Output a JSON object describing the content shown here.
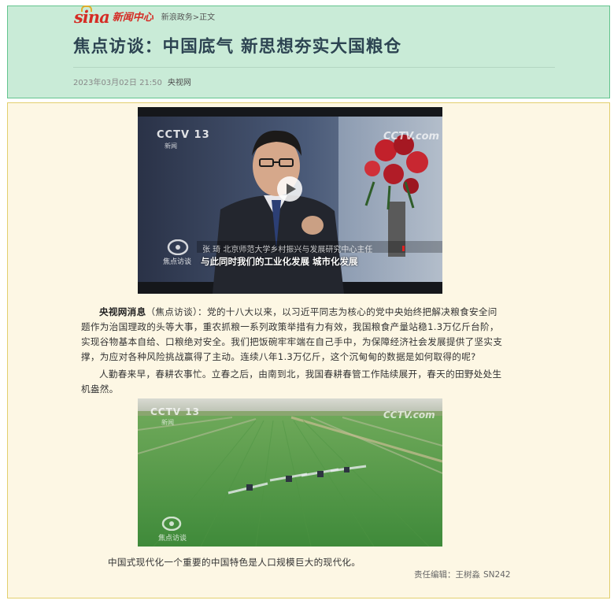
{
  "header": {
    "logo_text": "sina",
    "logo_subtitle": "新闻中心",
    "breadcrumb": [
      "新浪政务",
      ">",
      "正文"
    ],
    "title": "焦点访谈：中国底气 新思想夯实大国粮仓",
    "date": "2023年03月02日 21:50",
    "source": "央视网"
  },
  "video": {
    "channel_badge": "CCTV 13",
    "channel_sub": "新闻",
    "watermark": "CCTV.com",
    "program_logo": "焦点访谈",
    "speaker_caption": "张 琦 北京师范大学乡村振兴与发展研究中心主任",
    "subtitle": "与此同时我们的工业化发展 城市化发展"
  },
  "article": {
    "lead_source": "央视网消息",
    "lead_program": "（焦点访谈）：",
    "paragraph1": "党的十八大以来，以习近平同志为核心的党中央始终把解决粮食安全问题作为治国理政的头等大事，重农抓粮一系列政策举措有力有效，我国粮食产量站稳1.3万亿斤台阶，实现谷物基本自给、口粮绝对安全。我们把饭碗牢牢端在自己手中，为保障经济社会发展提供了坚实支撑，为应对各种风险挑战赢得了主动。连续八年1.3万亿斤，这个沉甸甸的数据是如何取得的呢?",
    "paragraph2": "人勤春来早，春耕农事忙。立春之后，由南到北，我国春耕春管工作陆续展开，春天的田野处处生机盎然。"
  },
  "photo": {
    "channel_badge": "CCTV 13",
    "channel_sub": "新闻",
    "watermark": "CCTV.com",
    "program_logo": "焦点访谈"
  },
  "caption": "中国式现代化一个重要的中国特色是人口规模巨大的现代化。",
  "editor": {
    "label": "责任编辑：王树淼",
    "code": "SN242"
  },
  "colors": {
    "header_bg": "#c9ebd7",
    "header_border": "#63c48e",
    "body_bg": "#fdf7e4",
    "body_border": "#e2cf6e",
    "title": "#2d4452",
    "brand_red": "#d52b24"
  }
}
